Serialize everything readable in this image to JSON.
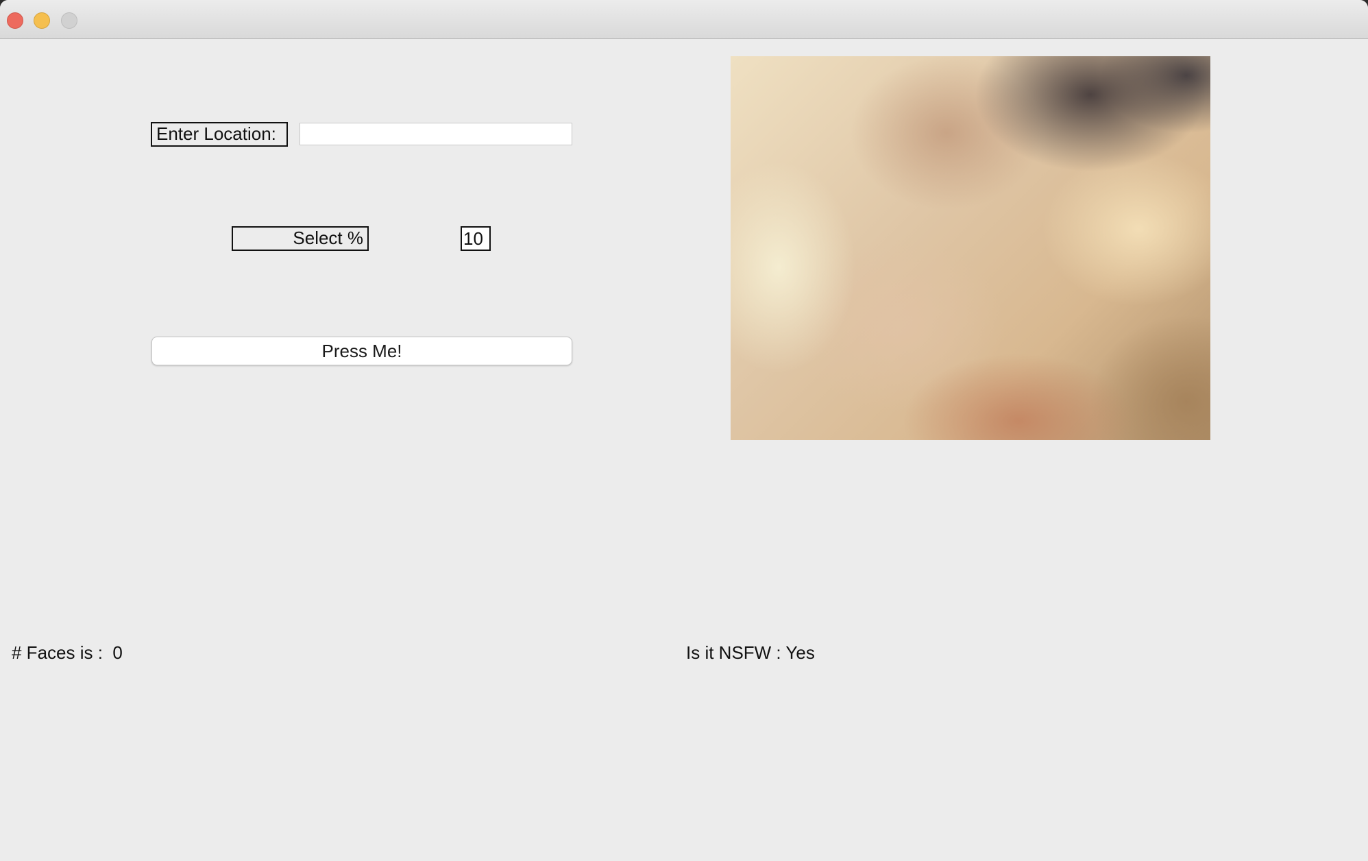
{
  "window": {
    "title": ""
  },
  "form": {
    "location_label": "Enter Location:",
    "location_value": "",
    "select_label": "Select %",
    "percent_value": "10",
    "press_button_label": "Press Me!"
  },
  "results": {
    "faces_text": "# Faces is :  0",
    "nsfw_text": "Is it NSFW : Yes"
  },
  "colors": {
    "window_bg": "#ececec",
    "close": "#ed6a5e",
    "minimize": "#f5bf4f",
    "zoom": "#d1d1d1"
  }
}
